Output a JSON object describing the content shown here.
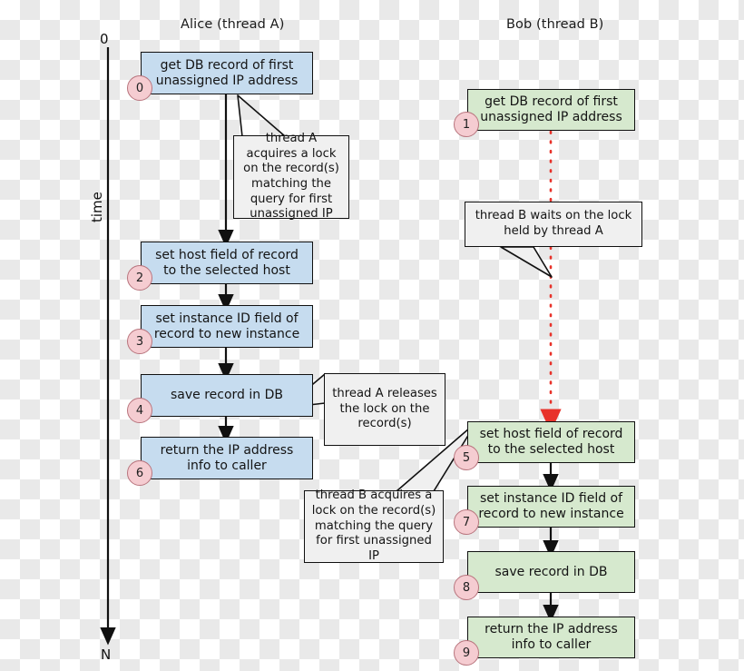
{
  "diagram": {
    "title_hidden": "",
    "columns": [
      {
        "id": "alice",
        "label": "Alice (thread A)"
      },
      {
        "id": "bob",
        "label": "Bob (thread B)"
      }
    ],
    "time_axis": {
      "label": "time",
      "start_label": "0",
      "end_label": "N"
    },
    "colors": {
      "alice_fill": "#c6dcef",
      "bob_fill": "#d6e9ce",
      "badge_fill": "#f5ccd1",
      "badge_stroke": "#b8747d",
      "callout_fill": "#f0f0f0",
      "stroke": "#111111",
      "wait_line": "#e8322a"
    },
    "alice_steps": [
      {
        "n": "0",
        "text": "get DB record of first unassigned IP address"
      },
      {
        "n": "2",
        "text": "set host field of record to the selected host"
      },
      {
        "n": "3",
        "text": "set instance ID field of record to new instance"
      },
      {
        "n": "4",
        "text": "save record in DB"
      },
      {
        "n": "6",
        "text": "return the IP address info to caller"
      }
    ],
    "bob_steps": [
      {
        "n": "1",
        "text": "get DB record of first unassigned IP address"
      },
      {
        "n": "5",
        "text": "set host field of record to the selected host"
      },
      {
        "n": "7",
        "text": "set instance ID field of record to new instance"
      },
      {
        "n": "8",
        "text": "save record in DB"
      },
      {
        "n": "9",
        "text": "return the IP address info to caller"
      }
    ],
    "callouts": [
      {
        "id": "lock-acquire-a",
        "text": "thread A acquires a lock on the record(s) matching the query for first unassigned IP"
      },
      {
        "id": "wait-b",
        "text": "thread B waits on the lock held by thread A"
      },
      {
        "id": "release-a",
        "text": "thread A releases the lock on the record(s)"
      },
      {
        "id": "lock-acquire-b",
        "text": "thread B acquires a lock on the record(s) matching the query for first unassigned IP"
      }
    ]
  }
}
